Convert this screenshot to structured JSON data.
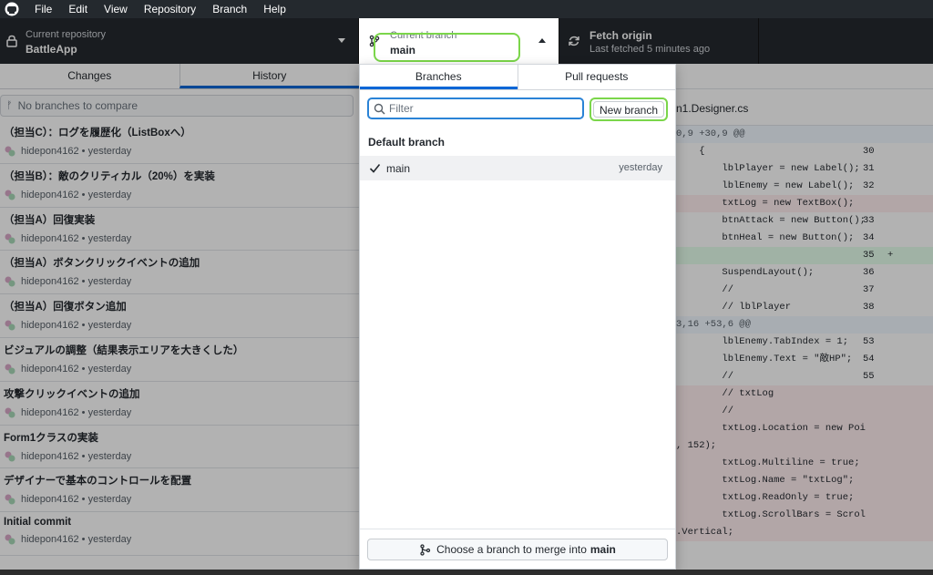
{
  "menubar": {
    "items": [
      "File",
      "Edit",
      "View",
      "Repository",
      "Branch",
      "Help"
    ]
  },
  "toolbar": {
    "repo": {
      "label": "Current repository",
      "value": "BattleApp"
    },
    "branch": {
      "label": "Current branch",
      "value": "main"
    },
    "fetch": {
      "label": "Fetch origin",
      "sub": "Last fetched 5 minutes ago"
    }
  },
  "left": {
    "tabs": [
      "Changes",
      "History"
    ],
    "compare_placeholder": "No branches to compare",
    "commits": [
      {
        "title": "（担当C）：ログを履歴化（ListBoxへ）",
        "author": "hidepon4162",
        "when": "yesterday"
      },
      {
        "title": "（担当B）：敵のクリティカル（20%）を実装",
        "author": "hidepon4162",
        "when": "yesterday"
      },
      {
        "title": "（担当A）回復実装",
        "author": "hidepon4162",
        "when": "yesterday"
      },
      {
        "title": "（担当A）ボタンクリックイベントの追加",
        "author": "hidepon4162",
        "when": "yesterday"
      },
      {
        "title": "（担当A）回復ボタン追加",
        "author": "hidepon4162",
        "when": "yesterday"
      },
      {
        "title": "ビジュアルの調整（結果表示エリアを大きくした）",
        "author": "hidepon4162",
        "when": "yesterday"
      },
      {
        "title": "攻撃クリックイベントの追加",
        "author": "hidepon4162",
        "when": "yesterday"
      },
      {
        "title": "Form1クラスの実装",
        "author": "hidepon4162",
        "when": "yesterday"
      },
      {
        "title": "デザイナーで基本のコントロールを配置",
        "author": "hidepon4162",
        "when": "yesterday"
      },
      {
        "title": "Initial commit",
        "author": "hidepon4162",
        "when": "yesterday"
      }
    ]
  },
  "diff": {
    "filename": "n1.Designer.cs",
    "lines": [
      {
        "kind": "hunk",
        "code": "0,9 +30,9 @@",
        "num": "",
        "sign": ""
      },
      {
        "kind": "ctx",
        "code": "    {",
        "num": "30",
        "sign": ""
      },
      {
        "kind": "ctx",
        "code": "        lblPlayer = new Label();",
        "num": "31",
        "sign": ""
      },
      {
        "kind": "ctx",
        "code": "        lblEnemy = new Label();",
        "num": "32",
        "sign": ""
      },
      {
        "kind": "del",
        "code": "        txtLog = new TextBox();",
        "num": "",
        "sign": ""
      },
      {
        "kind": "ctx",
        "code": "        btnAttack = new Button();",
        "num": "33",
        "sign": ""
      },
      {
        "kind": "ctx",
        "code": "        btnHeal = new Button();",
        "num": "34",
        "sign": ""
      },
      {
        "kind": "add",
        "code": "",
        "num": "35",
        "sign": "+"
      },
      {
        "kind": "ctx",
        "code": "        SuspendLayout();",
        "num": "36",
        "sign": ""
      },
      {
        "kind": "ctx",
        "code": "        //",
        "num": "37",
        "sign": ""
      },
      {
        "kind": "ctx",
        "code": "        // lblPlayer",
        "num": "38",
        "sign": ""
      },
      {
        "kind": "hunk",
        "code": "3,16 +53,6 @@",
        "num": "",
        "sign": ""
      },
      {
        "kind": "ctx",
        "code": "        lblEnemy.TabIndex = 1;",
        "num": "53",
        "sign": ""
      },
      {
        "kind": "ctx",
        "code": "        lblEnemy.Text = \"敵HP\";",
        "num": "54",
        "sign": ""
      },
      {
        "kind": "ctx",
        "code": "        //",
        "num": "55",
        "sign": ""
      },
      {
        "kind": "del",
        "code": "        // txtLog",
        "num": "",
        "sign": ""
      },
      {
        "kind": "del",
        "code": "        //",
        "num": "",
        "sign": ""
      },
      {
        "kind": "del",
        "code": "        txtLog.Location = new Poi",
        "num": "",
        "sign": ""
      },
      {
        "kind": "del",
        "code": ", 152);",
        "num": "",
        "sign": ""
      },
      {
        "kind": "del",
        "code": "        txtLog.Multiline = true;",
        "num": "",
        "sign": ""
      },
      {
        "kind": "del",
        "code": "        txtLog.Name = \"txtLog\";",
        "num": "",
        "sign": ""
      },
      {
        "kind": "del",
        "code": "        txtLog.ReadOnly = true;",
        "num": "",
        "sign": ""
      },
      {
        "kind": "del",
        "code": "        txtLog.ScrollBars = Scrol",
        "num": "",
        "sign": ""
      },
      {
        "kind": "del",
        "code": ".Vertical;",
        "num": "",
        "sign": ""
      }
    ]
  },
  "dropdown": {
    "tabs": [
      "Branches",
      "Pull requests"
    ],
    "filter_placeholder": "Filter",
    "new_branch_label": "New branch",
    "section": "Default branch",
    "branches": [
      {
        "name": "main",
        "when": "yesterday",
        "checked": true
      }
    ],
    "merge_prefix": "Choose a branch to merge into",
    "merge_target": "main"
  },
  "colors": {
    "accent": "#0366d6",
    "highlight": "#7bd64a",
    "toolbar": "#24292e"
  }
}
